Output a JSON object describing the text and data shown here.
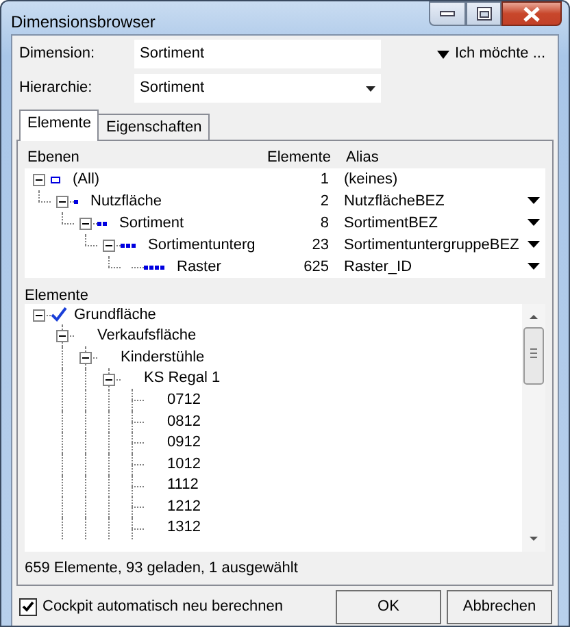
{
  "window": {
    "title": "Dimensionsbrowser"
  },
  "fields": [
    {
      "label": "Dimension:",
      "value": "Sortiment",
      "kind": "text"
    },
    {
      "label": "Hierarchie:",
      "value": "Sortiment",
      "kind": "dropdown"
    }
  ],
  "menu_link": {
    "label": "Ich möchte ..."
  },
  "tabs": [
    {
      "label": "Elemente",
      "selected": true
    },
    {
      "label": "Eigenschaften",
      "selected": false
    }
  ],
  "levels": {
    "columns": [
      "Ebenen",
      "Elemente",
      "Alias"
    ],
    "rows": [
      {
        "name": "(All)",
        "count": "1",
        "alias": "(keines)",
        "dropdown": false,
        "expanded": true,
        "children": [
          {
            "name": "Nutzfläche",
            "count": "2",
            "alias": "NutzflächeBEZ",
            "dropdown": true,
            "expanded": true,
            "children": [
              {
                "name": "Sortiment",
                "count": "8",
                "alias": "SortimentBEZ",
                "dropdown": true,
                "expanded": true,
                "children": [
                  {
                    "name": "Sortimentunterg",
                    "count": "23",
                    "alias": "SortimentuntergruppeBEZ",
                    "dropdown": true,
                    "expanded": true,
                    "children": [
                      {
                        "name": "Raster",
                        "count": "625",
                        "alias": "Raster_ID",
                        "dropdown": true
                      }
                    ]
                  }
                ]
              }
            ]
          }
        ]
      }
    ]
  },
  "elements": {
    "label": "Elemente",
    "items": [
      {
        "name": "Grundfläche",
        "selected": true,
        "expanded": true,
        "children": [
          {
            "name": "Verkaufsfläche",
            "selected": false,
            "expanded": true,
            "children": [
              {
                "name": "Kinderstühle",
                "selected": false,
                "expanded": true,
                "children": [
                  {
                    "name": "KS Regal 1",
                    "selected": false,
                    "expanded": true,
                    "children": [
                      {
                        "name": "0712",
                        "selected": false
                      },
                      {
                        "name": "0812",
                        "selected": false
                      },
                      {
                        "name": "0912",
                        "selected": false
                      },
                      {
                        "name": "1012",
                        "selected": false
                      },
                      {
                        "name": "1112",
                        "selected": false
                      },
                      {
                        "name": "1212",
                        "selected": false
                      },
                      {
                        "name": "1312",
                        "selected": false
                      }
                    ]
                  }
                ]
              }
            ]
          }
        ]
      }
    ],
    "status": "659 Elemente, 93 geladen, 1 ausgewählt"
  },
  "auto_recalc": {
    "label": "Cockpit automatisch neu berechnen",
    "checked": true
  },
  "buttons": [
    "OK",
    "Abbrechen"
  ]
}
